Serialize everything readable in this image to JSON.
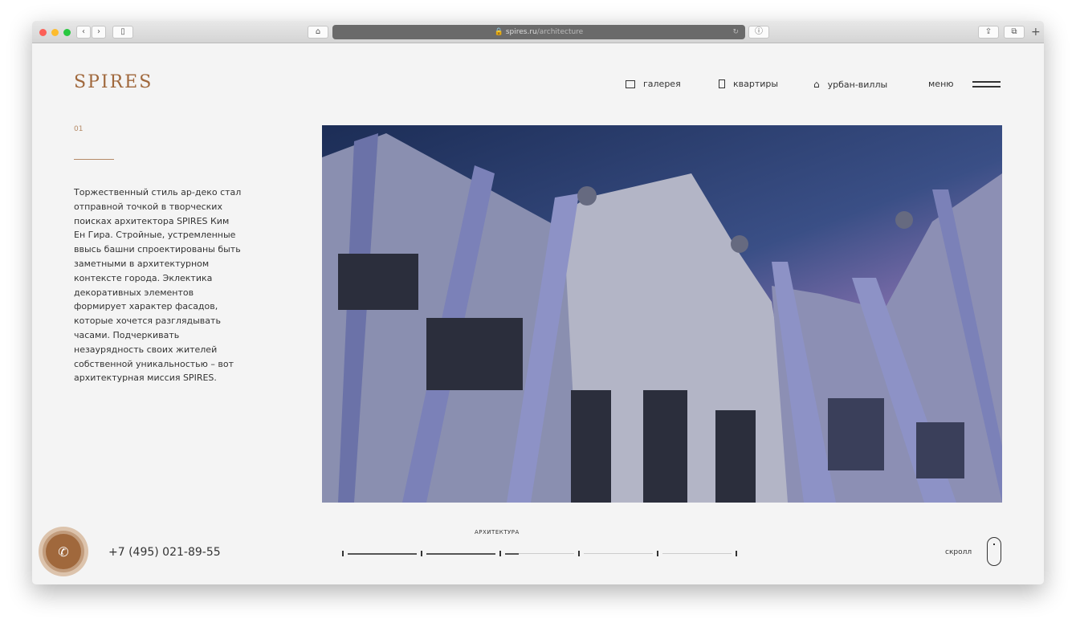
{
  "browser": {
    "url_host": "spires.ru",
    "url_path": "/architecture"
  },
  "header": {
    "logo": "SPIRES",
    "nav": [
      {
        "label": "галерея",
        "icon": "gallery-icon"
      },
      {
        "label": "квартиры",
        "icon": "door-icon"
      },
      {
        "label": "урбан-виллы",
        "icon": "house-icon"
      }
    ],
    "menu_label": "меню"
  },
  "intro": {
    "number": "01",
    "text": "Торжественный стиль ар-деко стал отправной точкой в творческих поисках архитектора SPIRES Ким Ен Гира. Стройные, устремленные ввысь башни спроектированы быть заметными в архитектурном контексте города. Эклектика декоративных элементов формирует характер фасадов, которые хочется разглядывать часами. Подчеркивать незаурядность своих жителей собственной уникальностью – вот архитектурная миссия SPIRES."
  },
  "footer": {
    "phone": "+7 (495) 021-89-55",
    "section_label": "АРХИТЕКТУРА",
    "progress": [
      1,
      1,
      0.2,
      0,
      0
    ],
    "scroll_label": "скролл"
  },
  "colors": {
    "accent": "#a0683c"
  }
}
